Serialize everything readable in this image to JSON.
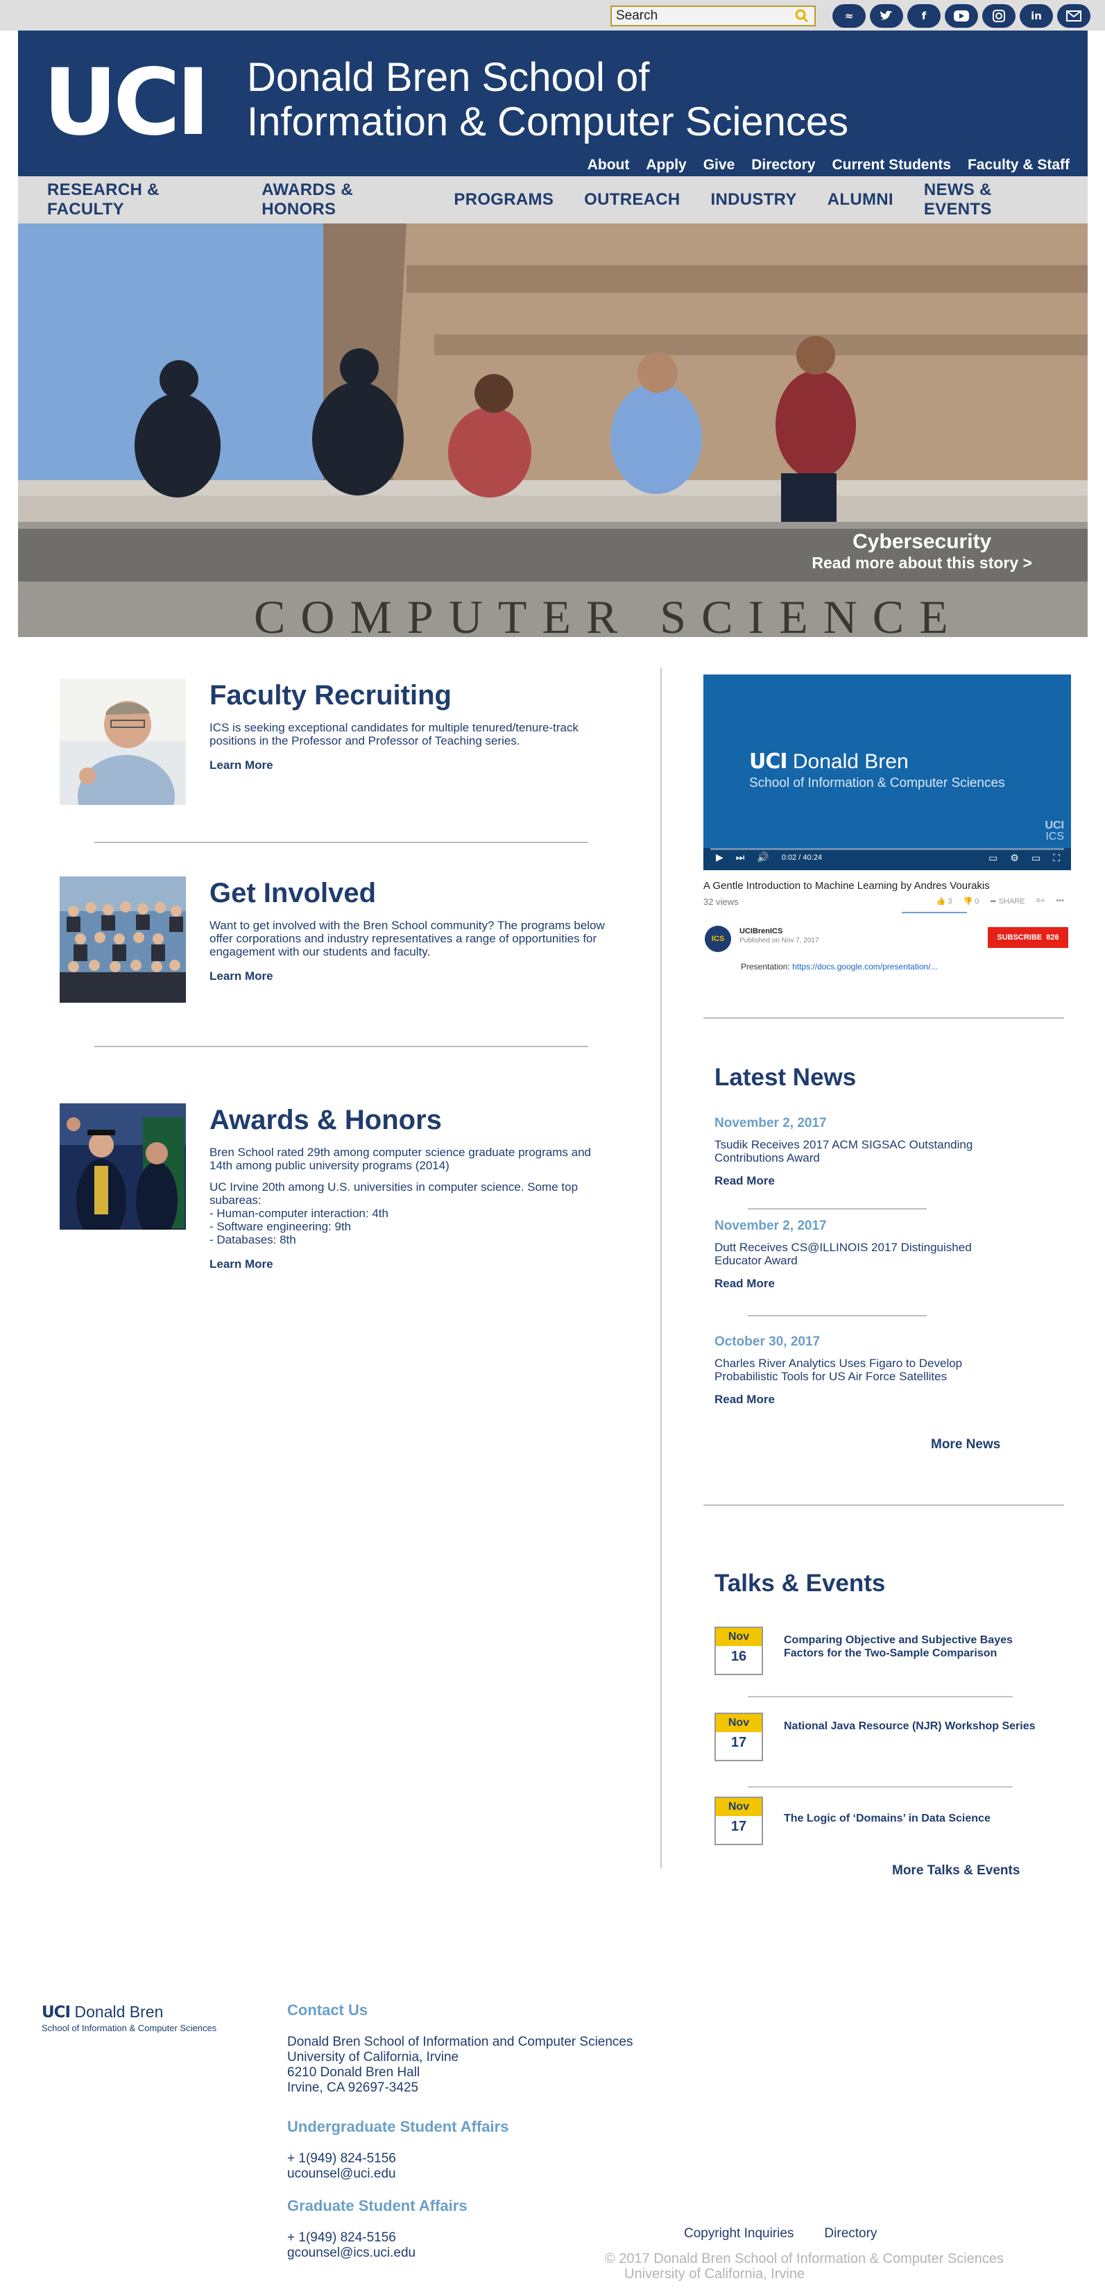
{
  "topbar": {
    "search_placeholder": "Search",
    "social": [
      {
        "icon": "anteater-icon",
        "glyph": "≈"
      },
      {
        "icon": "twitter-icon",
        "glyph": "🐦"
      },
      {
        "icon": "facebook-icon",
        "glyph": "f"
      },
      {
        "icon": "youtube-icon",
        "glyph": "▶"
      },
      {
        "icon": "instagram-icon",
        "glyph": "◎"
      },
      {
        "icon": "linkedin-icon",
        "glyph": "in"
      },
      {
        "icon": "email-icon",
        "glyph": "✉"
      }
    ]
  },
  "header": {
    "logo": "UCI",
    "school_line1": "Donald Bren School of",
    "school_line2": "Information & Computer Sciences",
    "util_links": [
      "About",
      "Apply",
      "Give",
      "Directory",
      "Current Students",
      "Faculty & Staff"
    ]
  },
  "nav": [
    "RESEARCH & FACULTY",
    "AWARDS & HONORS",
    "PROGRAMS",
    "OUTREACH",
    "INDUSTRY",
    "ALUMNI",
    "NEWS & EVENTS"
  ],
  "hero": {
    "title": "Cybersecurity",
    "link": "Read more about this story >",
    "building_text": "COMPUTER SCIENCE"
  },
  "features": [
    {
      "title": "Faculty Recruiting",
      "paragraphs": [
        "ICS is seeking exceptional candidates for multiple tenured/tenure-track positions in the Professor and Professor of Teaching series."
      ],
      "link": "Learn More"
    },
    {
      "title": "Get Involved",
      "paragraphs": [
        "Want to get involved with the Bren School community? The programs below offer corporations and industry representatives a range of opportunities for engagement with our students and faculty."
      ],
      "link": "Learn More"
    },
    {
      "title": "Awards & Honors",
      "paragraphs": [
        "Bren School rated 29th among computer science graduate programs and 14th among public university programs (2014)",
        "UC Irvine 20th among U.S. universities in computer science. Some top subareas:",
        "- Human-computer interaction: 4th",
        "- Software engineering: 9th",
        "- Databases: 8th"
      ],
      "link": "Learn More"
    }
  ],
  "video": {
    "brand": "UCI",
    "brand_name": "Donald Bren",
    "subtitle": "School of Information & Computer Sciences",
    "corner": "UCI",
    "corner2": "ICS",
    "time": "0:02 / 40:24",
    "title": "A Gentle Introduction to Machine Learning by Andres Vourakis",
    "views": "32 views",
    "likes": "3",
    "dislikes": "0",
    "share": "SHARE",
    "channel_avatar": "ICS",
    "channel": "UCIBrenICS",
    "published": "Published on Nov 7, 2017",
    "subscribe": "SUBSCRIBE",
    "sub_count": "826",
    "presentation_label": "Presentation:",
    "presentation_link": "https://docs.google.com/presentation/..."
  },
  "latest_news": {
    "heading": "Latest News",
    "items": [
      {
        "date": "November 2, 2017",
        "headline": "Tsudik Receives 2017 ACM SIGSAC Outstanding Contributions Award",
        "link": "Read More"
      },
      {
        "date": "November 2, 2017",
        "headline": "Dutt Receives CS@ILLINOIS 2017 Distinguished Educator Award",
        "link": "Read More"
      },
      {
        "date": "October 30, 2017",
        "headline": "Charles River Analytics Uses Figaro to Develop Probabilistic Tools for US Air Force Satellites",
        "link": "Read More"
      }
    ],
    "more": "More News"
  },
  "events": {
    "heading": "Talks & Events",
    "items": [
      {
        "month": "Nov",
        "day": "16",
        "title": "Comparing Objective and Subjective Bayes Factors for the Two-Sample Comparison"
      },
      {
        "month": "Nov",
        "day": "17",
        "title": "National Java Resource (NJR) Workshop Series"
      },
      {
        "month": "Nov",
        "day": "17",
        "title": "The Logic of ‘Domains’ in Data Science"
      }
    ],
    "more": "More Talks & Events"
  },
  "footer": {
    "logo_a": "UCI",
    "logo_b": "Donald Bren",
    "logo_c": "School of Information & Computer Sciences",
    "contact_heading": "Contact Us",
    "address": [
      "Donald Bren School of Information and Computer Sciences",
      "University of California, Irvine",
      "6210 Donald Bren Hall",
      "Irvine, CA 92697-3425"
    ],
    "ugrad_heading": "Undergraduate Student Affairs",
    "ugrad": [
      "+ 1(949) 824-5156",
      "ucounsel@uci.edu"
    ],
    "grad_heading": "Graduate Student Affairs",
    "grad": [
      "+ 1(949) 824-5156",
      "gcounsel@ics.uci.edu"
    ],
    "links": [
      "Copyright Inquiries",
      "Directory"
    ],
    "copyright1": "© 2017 Donald Bren School of Information & Computer Sciences",
    "copyright2": "University of California, Irvine"
  },
  "colors": {
    "navy": "#1d3d70",
    "gold": "#f2c500",
    "light_blue": "#6a9fc8",
    "gray_nav": "#dcdcdc"
  }
}
